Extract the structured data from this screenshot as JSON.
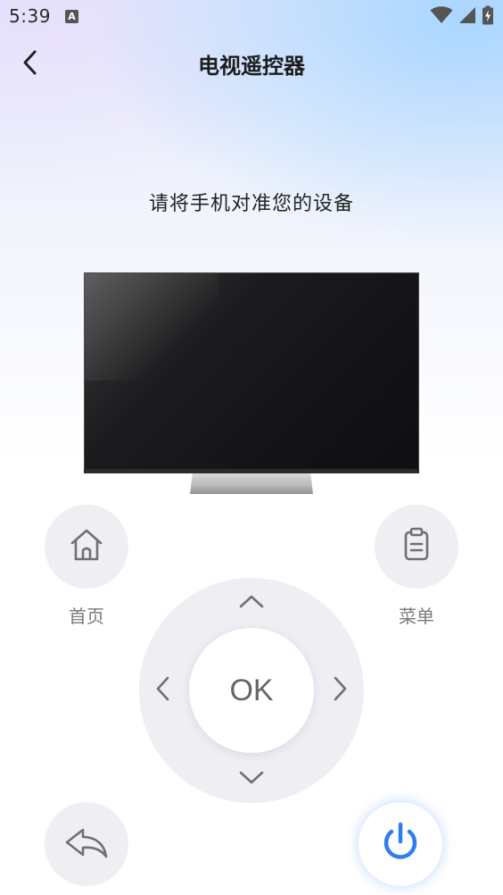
{
  "status_bar": {
    "time": "5:39",
    "notification_icon": "a-icon",
    "icons": [
      "wifi-icon",
      "cellular-signal-icon",
      "battery-charging-icon"
    ]
  },
  "header": {
    "title": "电视遥控器",
    "back_icon": "chevron-left-icon"
  },
  "instruction": "请将手机对准您的设备",
  "device_image": "tv-icon",
  "buttons": {
    "home": {
      "label": "首页",
      "icon": "home-icon"
    },
    "menu": {
      "label": "菜单",
      "icon": "clipboard-icon"
    },
    "back": {
      "icon": "return-arrow-icon"
    },
    "power": {
      "icon": "power-icon",
      "color": "#2f7df0"
    }
  },
  "dpad": {
    "ok_label": "OK",
    "up_icon": "chevron-up-icon",
    "down_icon": "chevron-down-icon",
    "left_icon": "chevron-left-icon",
    "right_icon": "chevron-right-icon"
  }
}
